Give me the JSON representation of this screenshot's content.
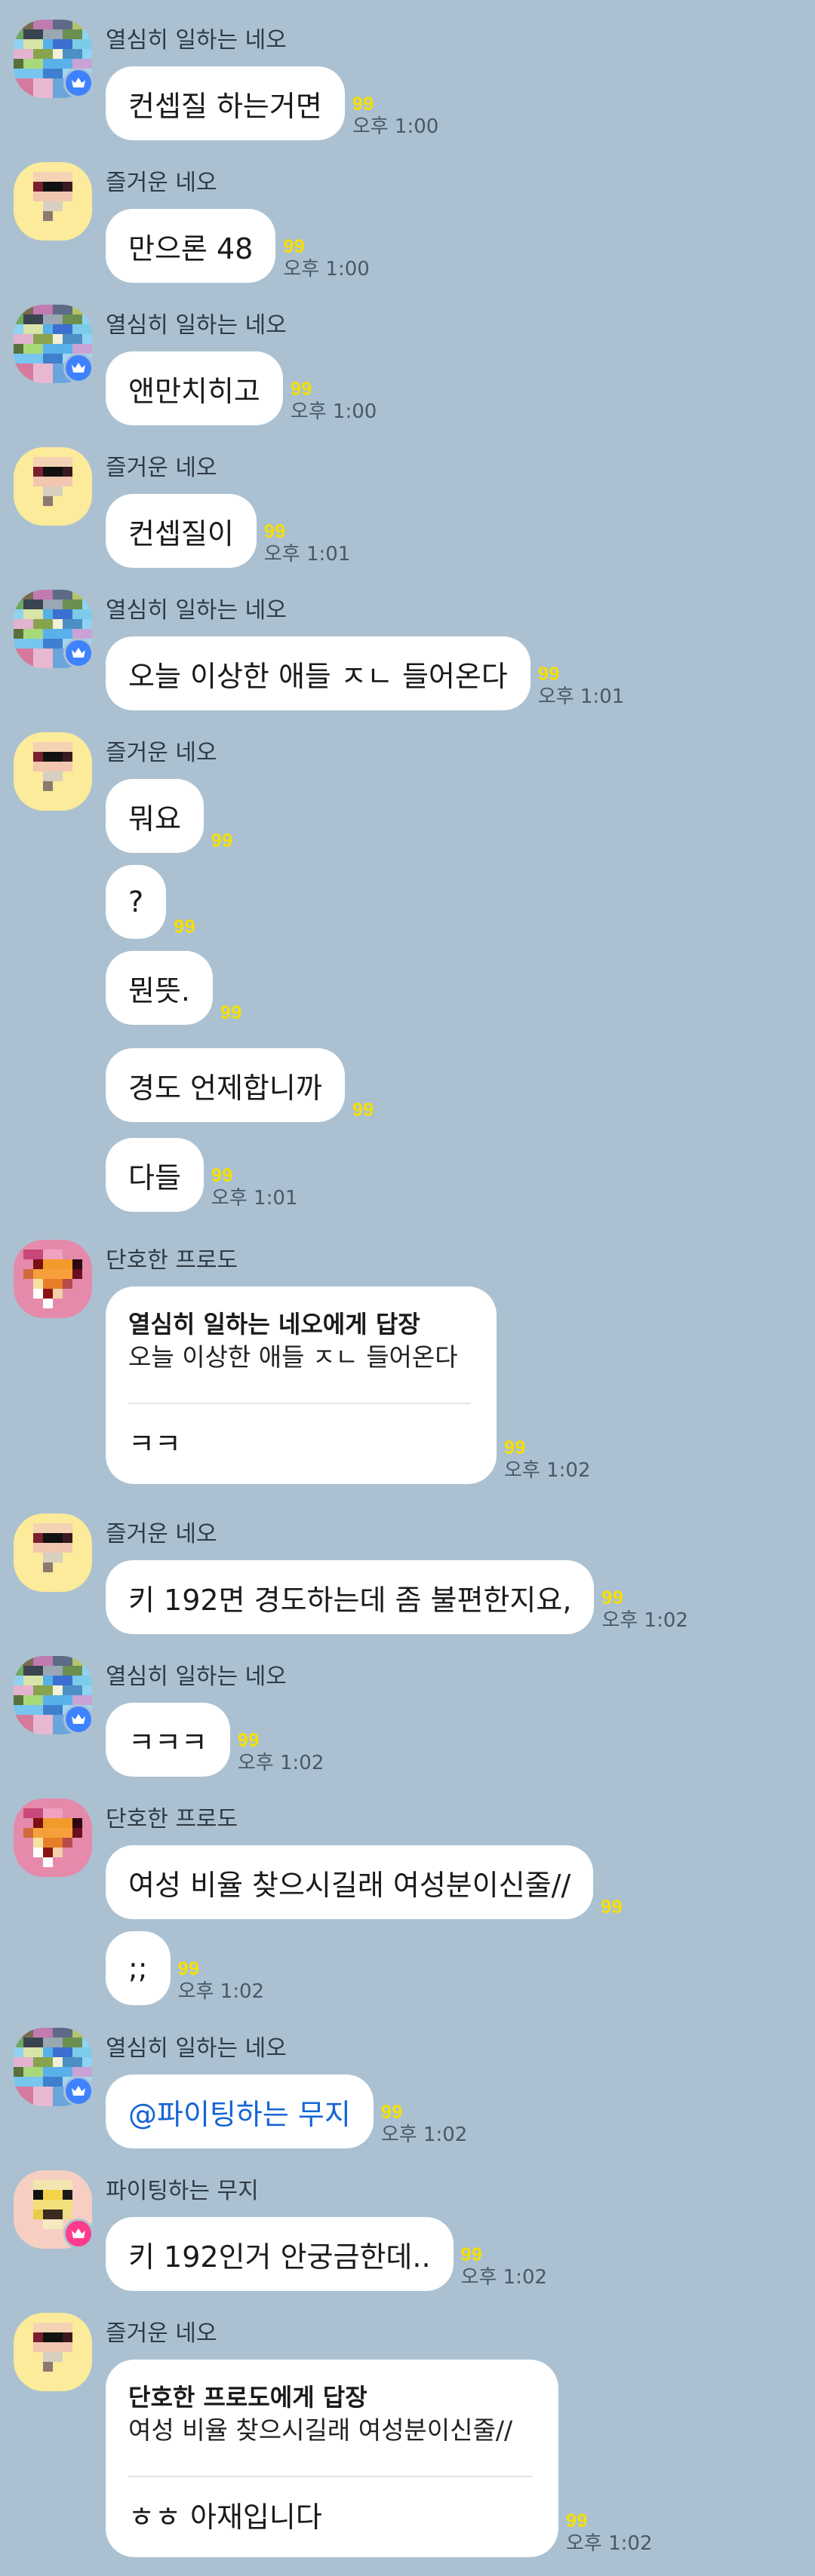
{
  "colors": {
    "background": "#abc1d1",
    "bubble": "#ffffff",
    "unread_count": "#f5df00",
    "mention": "#1464d6",
    "badge_blue": "#3e82ff",
    "badge_pink": "#ff3b8e"
  },
  "users": {
    "neo_work": {
      "name": "열심히 일하는 네오",
      "badge": "crown-icon"
    },
    "neo_happy": {
      "name": "즐거운 네오"
    },
    "frodo": {
      "name": "단호한 프로도"
    },
    "muzi": {
      "name": "파이팅하는 무지",
      "badge": "crown-icon"
    }
  },
  "messages": [
    {
      "text": "컨셉질 하는거면",
      "count": "99",
      "time": "오후 1:00"
    },
    {
      "text": "만으론 48",
      "count": "99",
      "time": "오후 1:00"
    },
    {
      "text": "앤만치히고",
      "count": "99",
      "time": "오후 1:00"
    },
    {
      "text": "컨셉질이",
      "count": "99",
      "time": "오후 1:01"
    },
    {
      "text": "오늘 이상한 애들 ㅈㄴ 들어온다",
      "count": "99",
      "time": "오후 1:01"
    },
    {
      "text": "뭐요",
      "count": "99"
    },
    {
      "text": "?",
      "count": "99"
    },
    {
      "text": "뭔뜻.",
      "count": "99"
    },
    {
      "text": "경도 언제합니까",
      "count": "99"
    },
    {
      "text": "다들",
      "count": "99",
      "time": "오후 1:01"
    },
    {
      "reply_title": "열심히 일하는 네오에게 답장",
      "quote": "오늘 이상한 애들 ㅈㄴ 들어온다",
      "text": "ㅋㅋ",
      "count": "99",
      "time": "오후 1:02"
    },
    {
      "text": "키 192면 경도하는데 좀 불편한지요,",
      "count": "99",
      "time": "오후 1:02"
    },
    {
      "text": "ㅋㅋㅋ",
      "count": "99",
      "time": "오후 1:02"
    },
    {
      "text": "여성 비율 찾으시길래 여성분이신줄//",
      "count": "99"
    },
    {
      "text": ";;",
      "count": "99",
      "time": "오후 1:02"
    },
    {
      "text": "@파이팅하는 무지",
      "count": "99",
      "time": "오후 1:02"
    },
    {
      "text": "키 192인거 안궁금한데..",
      "count": "99",
      "time": "오후 1:02"
    },
    {
      "reply_title": "단호한 프로도에게 답장",
      "quote": "여성 비율 찾으시길래 여성분이신줄//",
      "text": "ㅎㅎ 아재입니다",
      "count": "99",
      "time": "오후 1:02"
    }
  ]
}
